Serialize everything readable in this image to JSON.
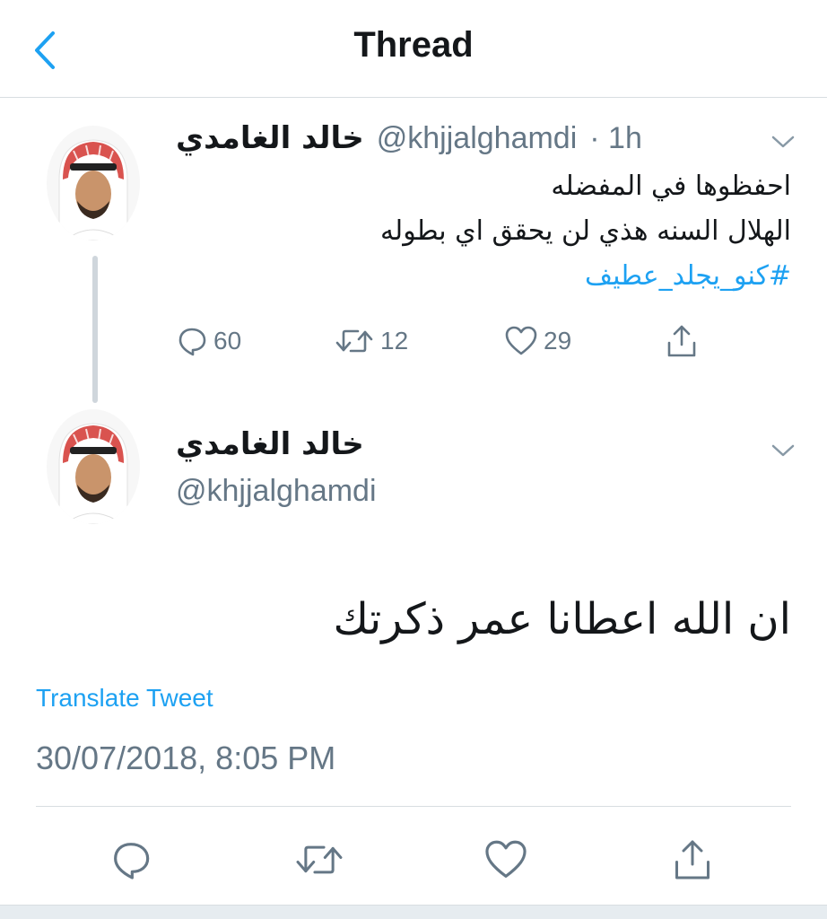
{
  "header": {
    "title": "Thread"
  },
  "tweet1": {
    "name": "خالد الغامدي",
    "handle": "@khjjalghamdi",
    "time": "· 1h",
    "lines": [
      "احفظوها في المفضله",
      "الهلال السنه هذي لن يحقق اي بطوله"
    ],
    "hashtag": "#كنو_يجلد_عطيف",
    "replies": "60",
    "retweets": "12",
    "likes": "29"
  },
  "tweet2": {
    "name": "خالد الغامدي",
    "handle": "@khjjalghamdi",
    "body": "ان الله اعطانا عمر ذكرتك",
    "translate_label": "Translate Tweet",
    "timestamp": "30/07/2018, 8:05 PM"
  },
  "colors": {
    "accent": "#1da1f2",
    "secondary_text": "#657786",
    "primary_text": "#14171a",
    "divider": "#d8dde1"
  },
  "icons": [
    "back-chevron-icon",
    "chevron-down-icon",
    "reply-icon",
    "retweet-icon",
    "like-icon",
    "share-icon"
  ]
}
